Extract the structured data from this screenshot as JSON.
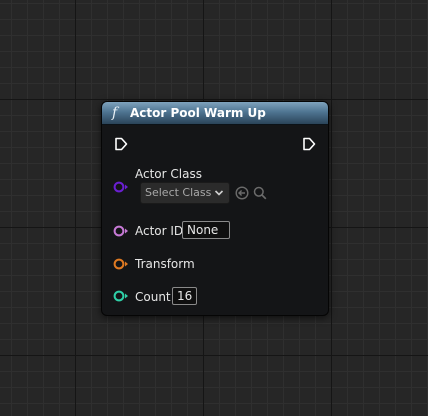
{
  "node": {
    "title": "Actor Pool Warm Up",
    "icon": "function-icon",
    "icon_glyph": "f",
    "header_color": "#4f7592"
  },
  "pins": {
    "actor_class": {
      "label": "Actor Class",
      "select_value": "Select Class",
      "color": "#6a1fd1"
    },
    "actor_id": {
      "label": "Actor ID",
      "value": "None",
      "color": "#c77ad6"
    },
    "transform": {
      "label": "Transform",
      "color": "#e07a22"
    },
    "count": {
      "label": "Count",
      "value": "16",
      "color": "#2fd0a8"
    }
  },
  "icons": {
    "use_selected": "arrow-left-circle-icon",
    "browse": "magnifier-icon",
    "dropdown": "chevron-down-icon",
    "exec_in": "exec-in-pin-icon",
    "exec_out": "exec-out-pin-icon"
  }
}
